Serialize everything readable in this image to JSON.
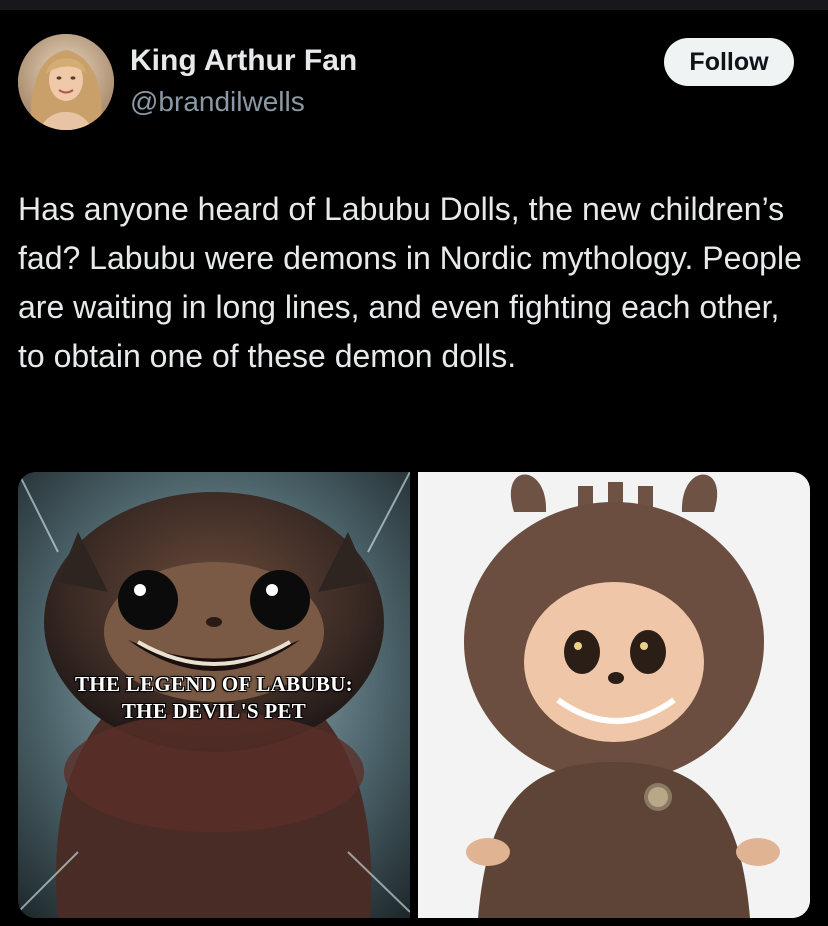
{
  "author": {
    "display_name": "King Arthur Fan",
    "handle": "@brandilwells",
    "avatar_icon": "profile-photo"
  },
  "follow_button": {
    "label": "Follow"
  },
  "tweet": {
    "text": "Has anyone heard of Labubu Dolls, the new children’s fad? Labubu were demons in Nordic mythology. People are waiting in long lines, and even fighting each other, to obtain one of these demon dolls."
  },
  "media": {
    "left_image": {
      "caption_line1": "THE LEGEND OF LABUBU:",
      "caption_line2": "THE DEVIL'S PET"
    },
    "right_image": {
      "description_icon": "plush-doll"
    }
  },
  "colors": {
    "background": "#000000",
    "text_primary": "#e7e9ea",
    "text_secondary": "#8b98a5",
    "follow_bg": "#eff3f4"
  }
}
